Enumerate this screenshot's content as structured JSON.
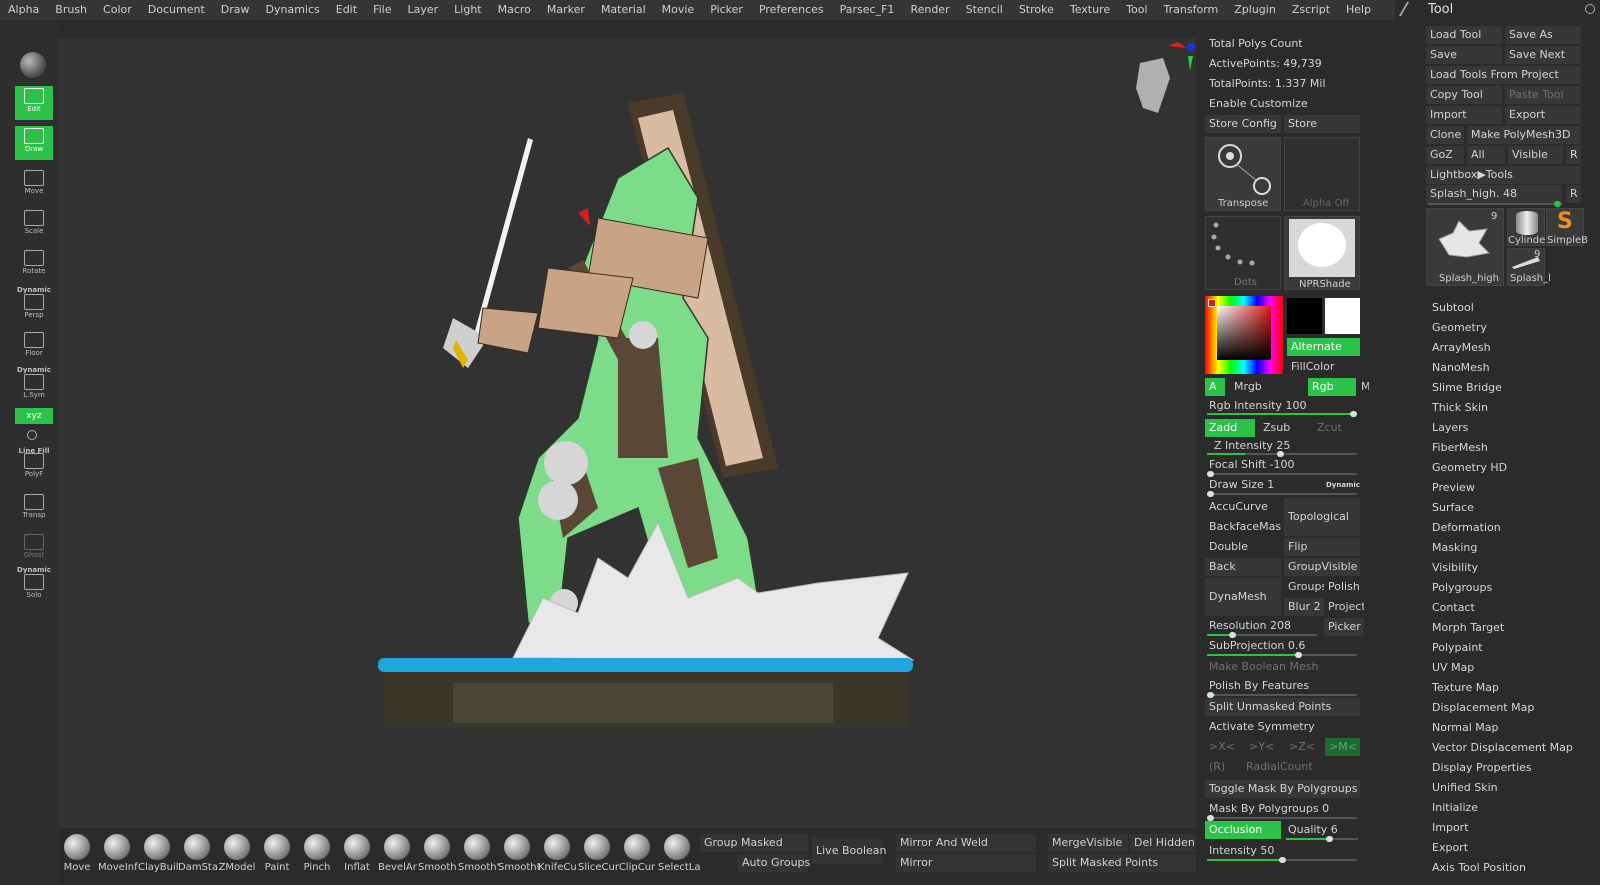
{
  "menu": [
    "Alpha",
    "Brush",
    "Color",
    "Document",
    "Draw",
    "Dynamics",
    "Edit",
    "File",
    "Layer",
    "Light",
    "Macro",
    "Marker",
    "Material",
    "Movie",
    "Picker",
    "Preferences",
    "Parsec_F1",
    "Render",
    "Stencil",
    "Stroke",
    "Texture",
    "Tool",
    "Transform",
    "Zplugin",
    "Zscript",
    "Help"
  ],
  "left": {
    "edit": "Edit",
    "draw": "Draw",
    "move": "Move",
    "scale": "Scale",
    "rotate": "Rotate",
    "dynamic1": "Dynamic",
    "persp": "Persp",
    "floor": "Floor",
    "dynamic2": "Dynamic",
    "lsym": "L.Sym",
    "xyz": "xyz",
    "linefill": "Line Fill",
    "polyf": "PolyF",
    "transp": "Transp",
    "ghost": "Ghost",
    "dynamic3": "Dynamic",
    "solo": "Solo"
  },
  "stats": {
    "total_polys": "Total Polys Count",
    "active_points": "ActivePoints: 49,739",
    "total_points": "TotalPoints: 1.337 Mil",
    "enable_customize": "Enable Customize",
    "store_config": "Store Config",
    "store": "Store"
  },
  "mid": {
    "transpose": "Transpose",
    "alpha_off": "Alpha Off",
    "dots": "Dots",
    "nprshade": "NPRShade",
    "alternate": "Alternate",
    "fillcolor": "FillColor",
    "a": "A",
    "mrgb": "Mrgb",
    "rgb": "Rgb",
    "m": "M",
    "rgb_intensity": "Rgb Intensity 100",
    "zadd": "Zadd",
    "zsub": "Zsub",
    "zcut": "Zcut",
    "z_intensity": "Z Intensity 25",
    "focal_shift": "Focal Shift -100",
    "draw_size": "Draw Size 1",
    "dynamic": "Dynamic",
    "accucurve": "AccuCurve",
    "topological": "Topological",
    "backfacemask": "BackfaceMask",
    "double": "Double",
    "flip": "Flip",
    "back": "Back",
    "groupvisible": "GroupVisible",
    "dynamesh": "DynaMesh",
    "groups": "Groups",
    "polish": "Polish",
    "blur": "Blur 2",
    "project": "Project",
    "resolution": "Resolution 208",
    "picker": "Picker",
    "subprojection": "SubProjection 0.6",
    "make_boolean": "Make Boolean Mesh",
    "polish_features": "Polish By Features",
    "split_unmasked": "Split Unmasked Points",
    "activate_symmetry": "Activate Symmetry",
    "sx": ">X<",
    "sy": ">Y<",
    "sz": ">Z<",
    "sm": ">M<",
    "rr": "(R)",
    "radialcount": "RadialCount",
    "toggle_mask": "Toggle Mask By Polygroups",
    "mask_polygroups": "Mask By Polygroups 0",
    "occlusion": "Occlusion",
    "quality": "Quality 6",
    "intensity": "Intensity 50"
  },
  "bottom": {
    "brushes": [
      "Move",
      "MoveInf",
      "ClayBuil",
      "DamSta",
      "ZModel",
      "Paint",
      "Pinch",
      "Inflat",
      "BevelAr",
      "Smooth",
      "Smooth'",
      "SmoothI",
      "KnifeCu",
      "SliceCur",
      "ClipCur",
      "SelectLa"
    ],
    "group_masked": "Group Masked",
    "auto_groups": "Auto Groups",
    "live_boolean": "Live Boolean",
    "mirror_and_weld": "Mirror And Weld",
    "mirror": "Mirror",
    "merge_visible": "MergeVisible",
    "del_hidden": "Del Hidden",
    "split_masked": "Split Masked Points"
  },
  "tool": {
    "title": "Tool",
    "load_tool": "Load Tool",
    "save_as": "Save As",
    "save": "Save",
    "save_next": "Save Next",
    "load_from_project": "Load Tools From Project",
    "copy_tool": "Copy Tool",
    "paste_tool": "Paste Tool",
    "import": "Import",
    "export": "Export",
    "clone": "Clone",
    "make_polymesh": "Make PolyMesh3D",
    "goz": "GoZ",
    "all": "All",
    "visible": "Visible",
    "r": "R",
    "lightbox": "Lightbox▶Tools",
    "splash_high": "Splash_high. 48",
    "r2": "R",
    "thumb_count": "9",
    "thumb_main": "Splash_high",
    "cylinder": "Cylinder",
    "simpleb": "SimpleB",
    "splash_l": "Splash_l",
    "thumb_count2": "9"
  },
  "subpalettes": [
    "Subtool",
    "Geometry",
    "ArrayMesh",
    "NanoMesh",
    "Slime Bridge",
    "Thick Skin",
    "Layers",
    "FiberMesh",
    "Geometry HD",
    "Preview",
    "Surface",
    "Deformation",
    "Masking",
    "Visibility",
    "Polygroups",
    "Contact",
    "Morph Target",
    "Polypaint",
    "UV Map",
    "Texture Map",
    "Displacement Map",
    "Normal Map",
    "Vector Displacement Map",
    "Display Properties",
    "Unified Skin",
    "Initialize",
    "Import",
    "Export",
    "Axis Tool Position"
  ]
}
